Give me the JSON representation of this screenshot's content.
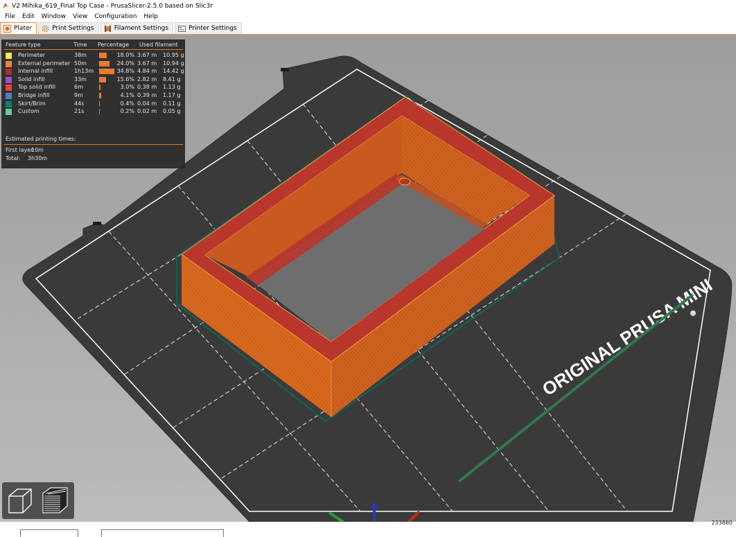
{
  "window": {
    "title": "V2 Mihika_619_Final Top Case - PrusaSlicer-2.5.0 based on Slic3r"
  },
  "menu": [
    "File",
    "Edit",
    "Window",
    "View",
    "Configuration",
    "Help"
  ],
  "tabs": [
    {
      "label": "Plater",
      "active": true,
      "icon": "plater-icon"
    },
    {
      "label": "Print Settings",
      "active": false,
      "icon": "gear-icon"
    },
    {
      "label": "Filament Settings",
      "active": false,
      "icon": "spool-icon"
    },
    {
      "label": "Printer Settings",
      "active": false,
      "icon": "printer-icon"
    }
  ],
  "legend": {
    "headers": {
      "feature": "Feature type",
      "time": "Time",
      "percentage": "Percentage",
      "filament": "Used filament"
    },
    "rows": [
      {
        "name": "Perimeter",
        "color": "#FFE64D",
        "time": "38m",
        "percent_value": 18.0,
        "percent": "18.0%",
        "length": "3.67 m",
        "weight": "10.95 g"
      },
      {
        "name": "External perimeter",
        "color": "#FF7D38",
        "time": "50m",
        "percent_value": 24.0,
        "percent": "24.0%",
        "length": "3.67 m",
        "weight": "10.94 g"
      },
      {
        "name": "Internal infill",
        "color": "#B03029",
        "time": "1h13m",
        "percent_value": 34.8,
        "percent": "34.8%",
        "length": "4.84 m",
        "weight": "14.42 g"
      },
      {
        "name": "Solid infill",
        "color": "#9654CC",
        "time": "33m",
        "percent_value": 15.6,
        "percent": "15.6%",
        "length": "2.82 m",
        "weight": "8.41 g"
      },
      {
        "name": "Top solid infill",
        "color": "#F04040",
        "time": "6m",
        "percent_value": 3.0,
        "percent": "3.0%",
        "length": "0.38 m",
        "weight": "1.13 g"
      },
      {
        "name": "Bridge infill",
        "color": "#4D80BA",
        "time": "9m",
        "percent_value": 4.1,
        "percent": "4.1%",
        "length": "0.39 m",
        "weight": "1.17 g"
      },
      {
        "name": "Skirt/Brim",
        "color": "#00876E",
        "time": "44s",
        "percent_value": 0.4,
        "percent": "0.4%",
        "length": "0.04 m",
        "weight": "0.11 g"
      },
      {
        "name": "Custom",
        "color": "#5ED194",
        "time": "21s",
        "percent_value": 0.2,
        "percent": "0.2%",
        "length": "0.02 m",
        "weight": "0.05 g"
      }
    ],
    "estimated_title": "Estimated printing times:",
    "first_layer_label": "First layer:",
    "first_layer_value": "10m",
    "total_label": "Total:",
    "total_value": "3h30m"
  },
  "bed": {
    "brand_text": "ORIGINAL PRUSA MINI"
  },
  "colors": {
    "accent": "#FF8A3D",
    "model_wall": "#D8691E",
    "model_top": "#C03A2C",
    "bed": "#3A3A3A",
    "legend_bg": "#262626"
  },
  "view_buttons": [
    {
      "name": "3d-view",
      "icon": "cube-icon"
    },
    {
      "name": "preview",
      "icon": "layers-icon"
    }
  ],
  "status": {
    "corner_value": "233860"
  }
}
